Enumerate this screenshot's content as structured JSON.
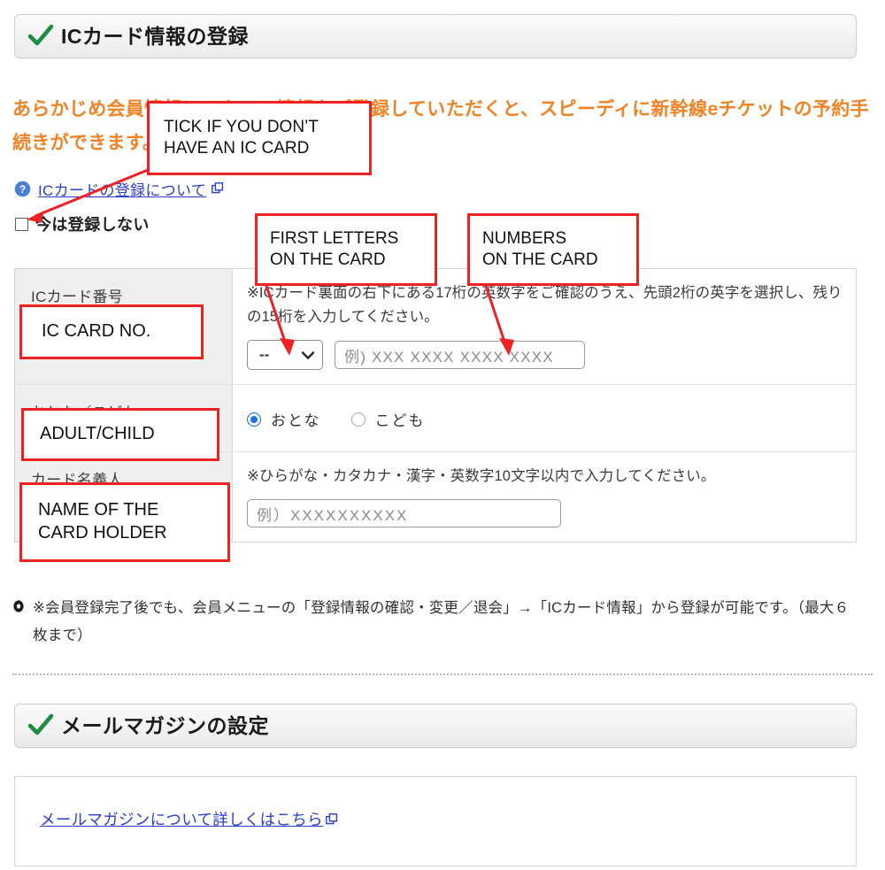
{
  "sections": {
    "ic_card": {
      "heading": "ICカード情報の登録",
      "lead": "あらかじめ会員情報にICカード情報をご登録していただくと、スピーディに新幹線eチケットの予約手続きができます。",
      "help_link": "ICカードの登録について",
      "checkbox_label": "今は登録しない",
      "checkbox_checked": false,
      "table": {
        "rows": [
          {
            "label": "ICカード番号",
            "note": "※ICカード裏面の右下にある17桁の英数字をご確認のうえ、先頭2桁の英字を選択し、残りの15桁を入力してください。",
            "select_value": "--",
            "input_placeholder": "例) XXX XXXX XXXX XXXX"
          },
          {
            "label": "おとな／こども",
            "options": [
              {
                "label": "おとな",
                "selected": true
              },
              {
                "label": "こども",
                "selected": false
              }
            ]
          },
          {
            "label": "カード名義人",
            "note": "※ひらがな・カタカナ・漢字・英数字10文字以内で入力してください。",
            "input_placeholder": "例）XXXXXXXXXX"
          }
        ]
      },
      "bullet_note": "※会員登録完了後でも、会員メニューの「登録情報の確認・変更／退会」→「ICカード情報」から登録が可能です。（最大６枚まで）"
    },
    "mail_magazine": {
      "heading": "メールマガジンの設定",
      "link": "メールマガジンについて詳しくはこちら"
    }
  },
  "annotations": [
    {
      "id": "tick-no-card",
      "line1": "TICK IF YOU DON’T",
      "line2": "HAVE AN IC CARD"
    },
    {
      "id": "first-letters",
      "line1": "FIRST LETTERS",
      "line2": "ON THE CARD"
    },
    {
      "id": "numbers",
      "line1": "NUMBERS",
      "line2": "ON THE CARD"
    },
    {
      "id": "ic-card-no",
      "line1": "IC CARD NO.",
      "line2": ""
    },
    {
      "id": "adult-child",
      "line1": "ADULT/CHILD",
      "line2": ""
    },
    {
      "id": "card-holder",
      "line1": "NAME OF THE",
      "line2": "CARD HOLDER"
    }
  ],
  "colors": {
    "lead_orange": "#ef8326",
    "link_blue": "#2b3ecb",
    "annotation_red": "#ee2222",
    "check_green": "#1c8c42",
    "radio_blue": "#1a73e8"
  }
}
